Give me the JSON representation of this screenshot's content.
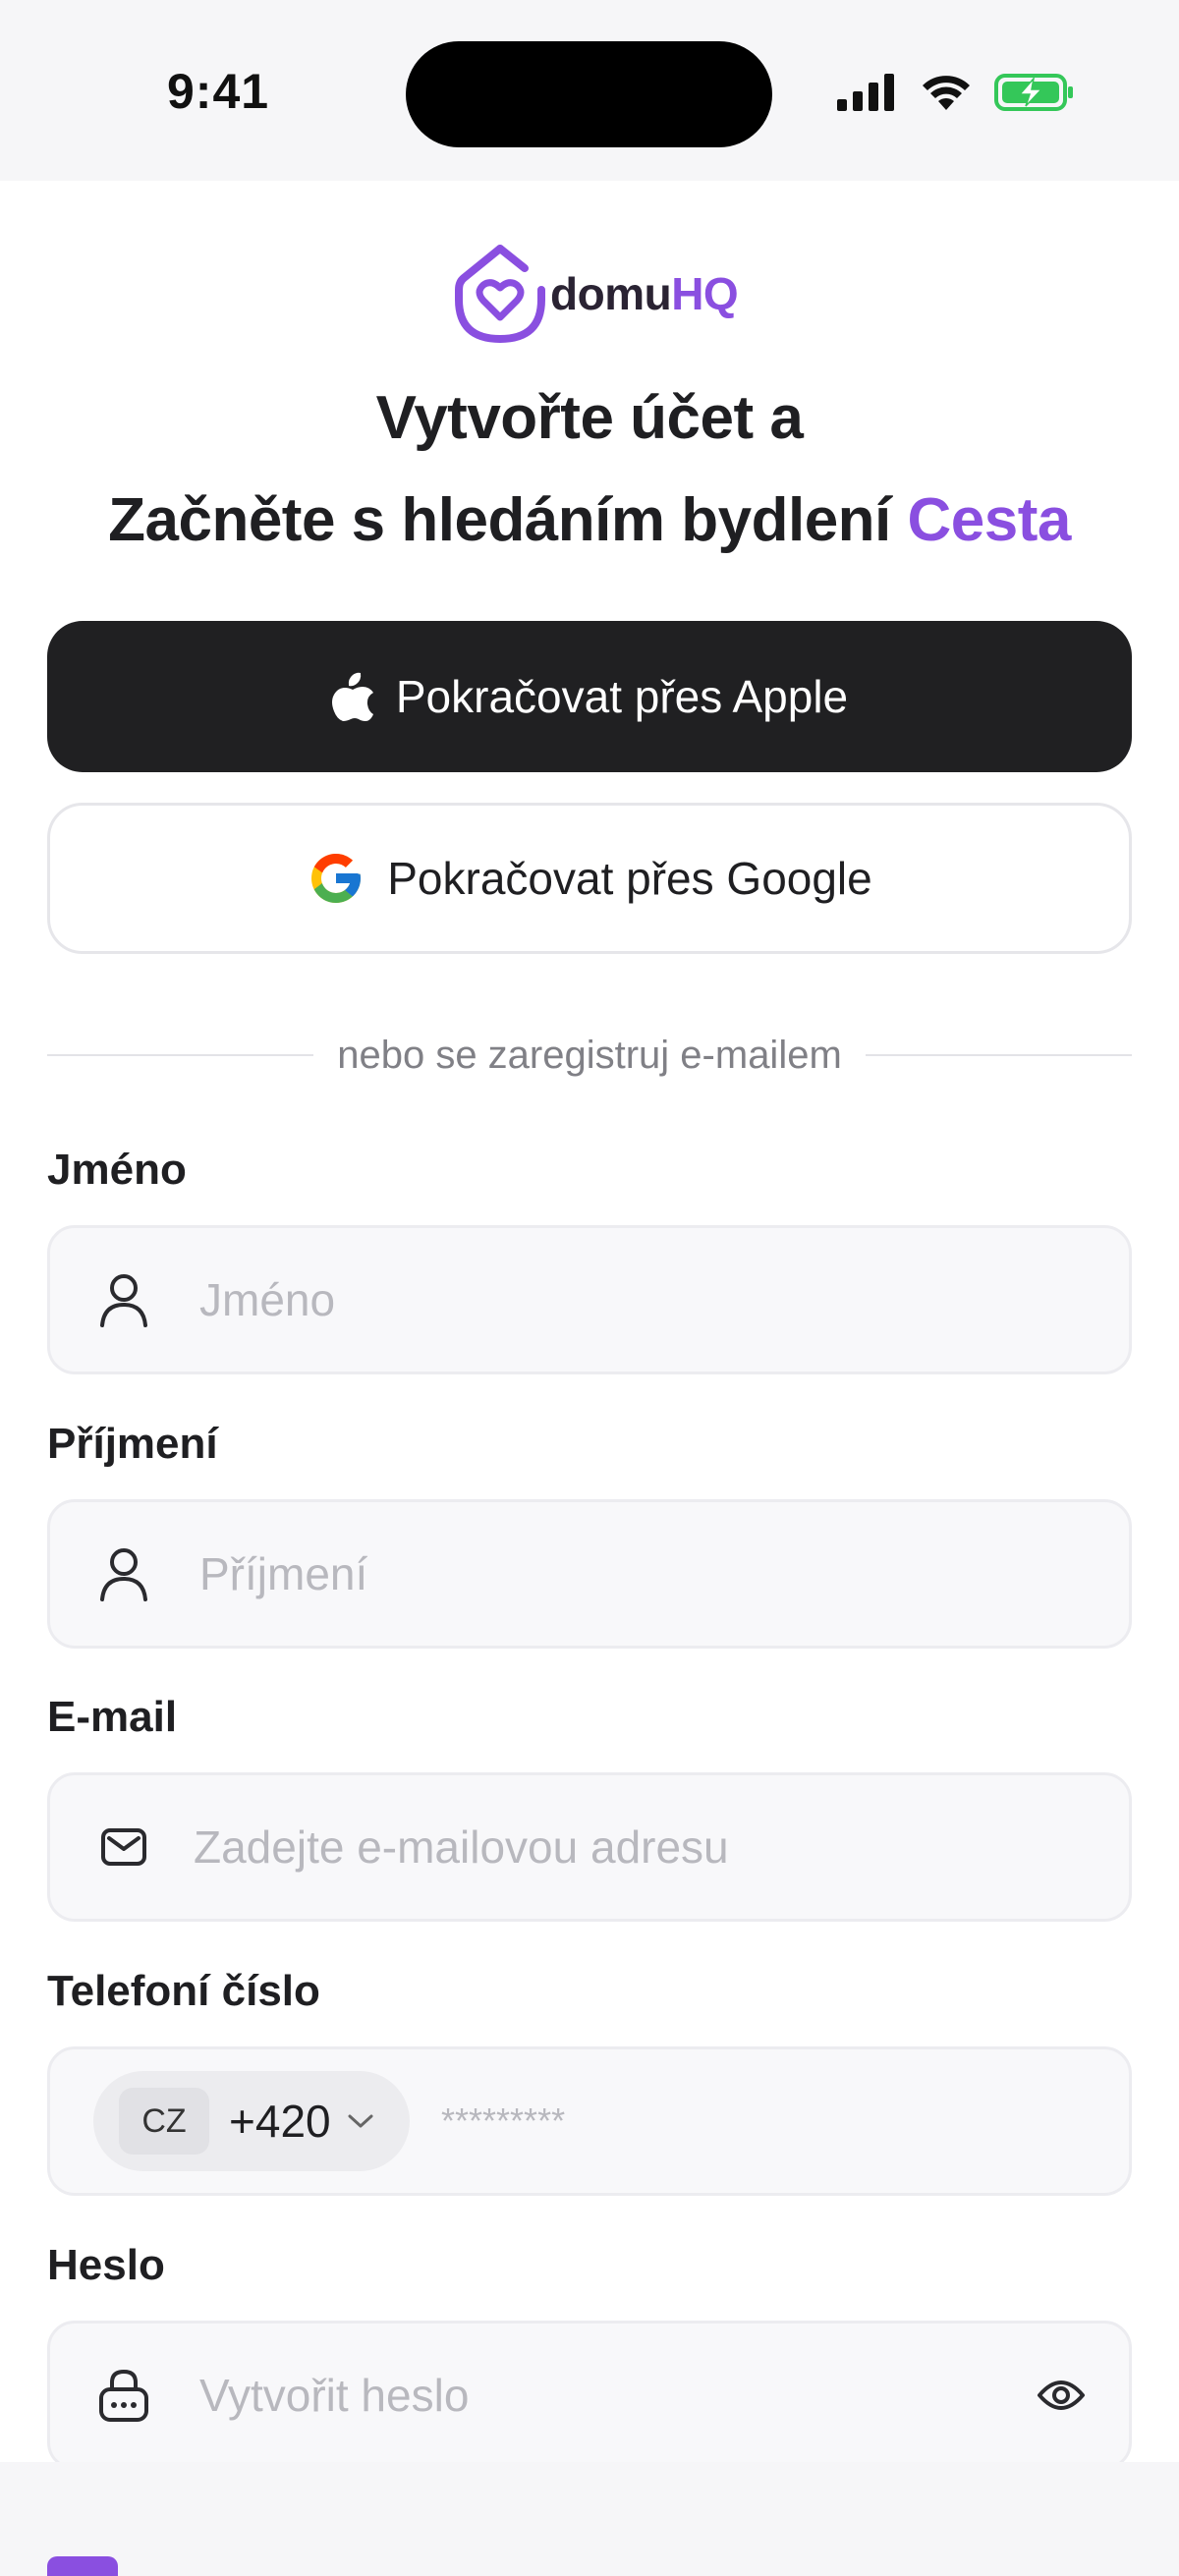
{
  "status": {
    "time": "9:41"
  },
  "brand": {
    "name_part1": "domu",
    "name_part2": "HQ",
    "accent_color": "#8a4fe0"
  },
  "headline": {
    "line1": "Vytvořte účet a",
    "line2_main": "Začněte s hledáním bydlení",
    "line2_accent": "Cesta"
  },
  "social": {
    "apple_label": "Pokračovat přes Apple",
    "google_label": "Pokračovat přes Google"
  },
  "divider": {
    "text": "nebo se zaregistruj e-mailem"
  },
  "form": {
    "first_name": {
      "label": "Jméno",
      "placeholder": "Jméno",
      "icon": "user-icon"
    },
    "last_name": {
      "label": "Příjmení",
      "placeholder": "Příjmení",
      "icon": "user-icon"
    },
    "email": {
      "label": "E-mail",
      "placeholder": "Zadejte e-mailovou adresu",
      "icon": "mail-icon"
    },
    "phone": {
      "label": "Telefoní číslo",
      "country_code": "CZ",
      "dial_code": "+420",
      "placeholder": "*********"
    },
    "password": {
      "label": "Heslo",
      "placeholder": "Vytvořit heslo",
      "icon": "lock-icon"
    }
  }
}
